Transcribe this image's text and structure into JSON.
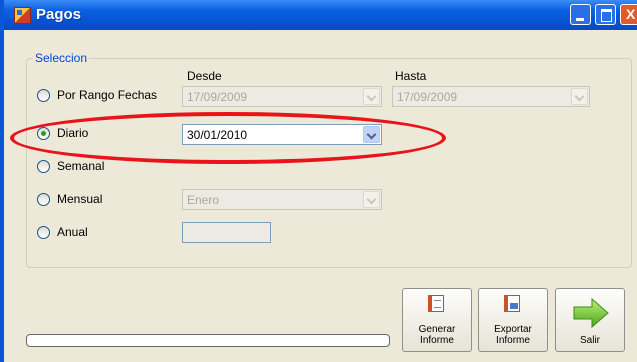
{
  "window": {
    "title": "Pagos"
  },
  "group": {
    "legend": "Seleccion",
    "headers": {
      "desde": "Desde",
      "hasta": "Hasta"
    },
    "options": {
      "rango": {
        "label": "Por Rango Fechas",
        "desde_value": "17/09/2009",
        "hasta_value": "17/09/2009"
      },
      "diario": {
        "label": "Diario",
        "value": "30/01/2010",
        "selected": true
      },
      "semanal": {
        "label": "Semanal"
      },
      "mensual": {
        "label": "Mensual",
        "value": "Enero"
      },
      "anual": {
        "label": "Anual",
        "value": ""
      }
    }
  },
  "buttons": {
    "generar": [
      "Generar",
      "Informe"
    ],
    "exportar": [
      "Exportar",
      "Informe"
    ],
    "salir": "Salir"
  },
  "progress": {
    "value": 0
  },
  "colors": {
    "highlight": "#e8141a",
    "title_bar": "#0a5fe0"
  }
}
